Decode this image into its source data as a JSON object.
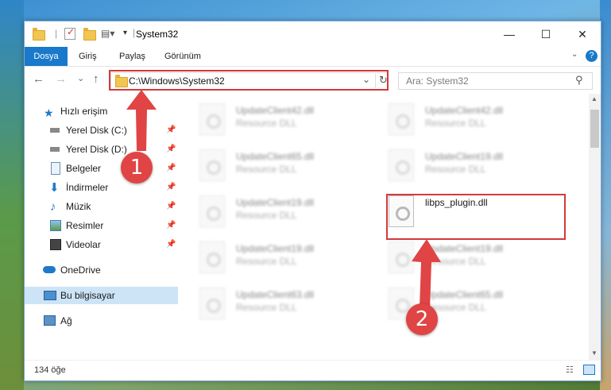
{
  "window": {
    "title": "System32",
    "controls": {
      "minimize": "—",
      "maximize": "☐",
      "close": "✕"
    }
  },
  "ribbon": {
    "tabs": [
      "Dosya",
      "Giriş",
      "Paylaş",
      "Görünüm"
    ],
    "help": "?"
  },
  "nav": {
    "back": "←",
    "forward": "→",
    "recent": "⌄",
    "up": "↑",
    "address": "C:\\Windows\\System32",
    "refresh": "↻"
  },
  "search": {
    "placeholder": "Ara: System32"
  },
  "sidebar": {
    "items": [
      {
        "label": "Hızlı erişim",
        "icon": "star-icon",
        "pinned": false
      },
      {
        "label": "Yerel Disk (C:)",
        "icon": "drive-icon",
        "pinned": true
      },
      {
        "label": "Yerel Disk (D:)",
        "icon": "drive-icon",
        "pinned": true
      },
      {
        "label": "Belgeler",
        "icon": "documents-icon",
        "pinned": true
      },
      {
        "label": "İndirmeler",
        "icon": "download-icon",
        "pinned": true
      },
      {
        "label": "Müzik",
        "icon": "music-icon",
        "pinned": true
      },
      {
        "label": "Resimler",
        "icon": "pictures-icon",
        "pinned": true
      },
      {
        "label": "Videolar",
        "icon": "video-icon",
        "pinned": true
      },
      {
        "label": "OneDrive",
        "icon": "cloud-icon",
        "pinned": false
      },
      {
        "label": "Bu bilgisayar",
        "icon": "computer-icon",
        "pinned": false
      },
      {
        "label": "Ağ",
        "icon": "network-icon",
        "pinned": false
      }
    ],
    "pin_glyph": "📌"
  },
  "files": {
    "tiles": [
      {
        "name": "UpdateClient42.dll",
        "type": "Resource DLL"
      },
      {
        "name": "UpdateClient42.dll",
        "type": "Resource DLL"
      },
      {
        "name": "UpdateClient65.dll",
        "type": "Resource DLL"
      },
      {
        "name": "UpdateClient19.dll",
        "type": "Resource DLL"
      },
      {
        "name": "UpdateClient19.dll",
        "type": "Resource DLL"
      },
      {
        "name": "libps_plugin.dll",
        "type": ""
      },
      {
        "name": "UpdateClient19.dll",
        "type": "Resource DLL"
      },
      {
        "name": "UpdateClient19.dll",
        "type": "Resource DLL"
      },
      {
        "name": "UpdateClient63.dll",
        "type": "Resource DLL"
      },
      {
        "name": "UpdateClient65.dll",
        "type": "Resource DLL"
      }
    ]
  },
  "status": {
    "count": "134 öğe"
  },
  "annotations": {
    "step1": "1",
    "step2": "2",
    "color": "#e04444"
  }
}
